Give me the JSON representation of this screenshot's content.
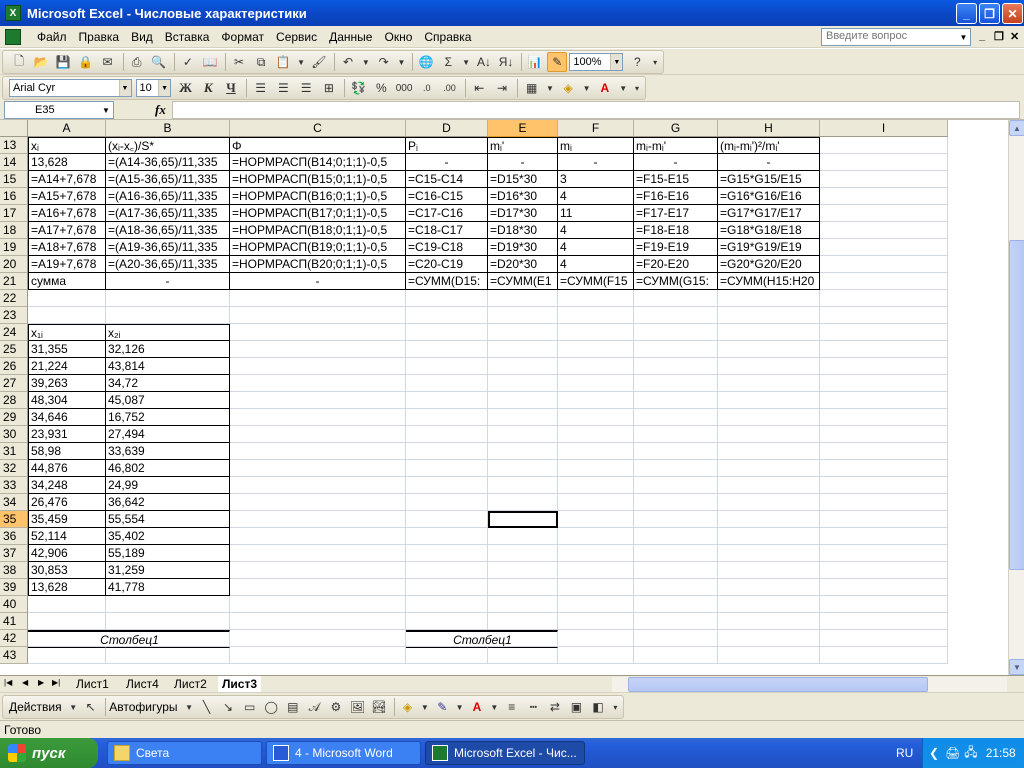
{
  "window": {
    "title": "Microsoft Excel - Числовые характеристики"
  },
  "menu": [
    "Файл",
    "Правка",
    "Вид",
    "Вставка",
    "Формат",
    "Сервис",
    "Данные",
    "Окно",
    "Справка"
  ],
  "help_placeholder": "Введите вопрос",
  "toolbar": {
    "zoom": "100%",
    "font": "Arial Cyr",
    "size": "10",
    "bold": "Ж",
    "italic": "К",
    "underline": "Ч",
    "percent": "%",
    "thousands": "000",
    "sum": "Σ"
  },
  "formula_bar": {
    "namebox": "E35",
    "fx": "fx",
    "content": ""
  },
  "columns": [
    "A",
    "B",
    "C",
    "D",
    "E",
    "F",
    "G",
    "H",
    "I"
  ],
  "rows": [
    {
      "n": "13",
      "cells": [
        "xᵢ",
        "(xᵢ-x꜀)/S*",
        "Φ",
        "Pᵢ",
        "mᵢ'",
        "mᵢ",
        "mᵢ-mᵢ'",
        "(mᵢ-mᵢ')²/mᵢ'",
        ""
      ]
    },
    {
      "n": "14",
      "cells": [
        "13,628",
        "=(A14-36,65)/11,335",
        "=НОРМРАСП(B14;0;1;1)-0,5",
        "-",
        "-",
        "-",
        "-",
        "-",
        ""
      ]
    },
    {
      "n": "15",
      "cells": [
        "=A14+7,678",
        "=(A15-36,65)/11,335",
        "=НОРМРАСП(B15;0;1;1)-0,5",
        "=C15-C14",
        "=D15*30",
        "3",
        "=F15-E15",
        "=G15*G15/E15",
        ""
      ]
    },
    {
      "n": "16",
      "cells": [
        "=A15+7,678",
        "=(A16-36,65)/11,335",
        "=НОРМРАСП(B16;0;1;1)-0,5",
        "=C16-C15",
        "=D16*30",
        "4",
        "=F16-E16",
        "=G16*G16/E16",
        ""
      ]
    },
    {
      "n": "17",
      "cells": [
        "=A16+7,678",
        "=(A17-36,65)/11,335",
        "=НОРМРАСП(B17;0;1;1)-0,5",
        "=C17-C16",
        "=D17*30",
        "11",
        "=F17-E17",
        "=G17*G17/E17",
        ""
      ]
    },
    {
      "n": "18",
      "cells": [
        "=A17+7,678",
        "=(A18-36,65)/11,335",
        "=НОРМРАСП(B18;0;1;1)-0,5",
        "=C18-C17",
        "=D18*30",
        "4",
        "=F18-E18",
        "=G18*G18/E18",
        ""
      ]
    },
    {
      "n": "19",
      "cells": [
        "=A18+7,678",
        "=(A19-36,65)/11,335",
        "=НОРМРАСП(B19;0;1;1)-0,5",
        "=C19-C18",
        "=D19*30",
        "4",
        "=F19-E19",
        "=G19*G19/E19",
        ""
      ]
    },
    {
      "n": "20",
      "cells": [
        "=A19+7,678",
        "=(A20-36,65)/11,335",
        "=НОРМРАСП(B20;0;1;1)-0,5",
        "=C20-C19",
        "=D20*30",
        "4",
        "=F20-E20",
        "=G20*G20/E20",
        ""
      ]
    },
    {
      "n": "21",
      "cells": [
        "сумма",
        "-",
        "-",
        "=СУММ(D15:",
        "=СУММ(E1",
        "=СУММ(F15",
        "=СУММ(G15:",
        "=СУММ(H15:H20",
        ""
      ]
    },
    {
      "n": "22",
      "cells": [
        "",
        "",
        "",
        "",
        "",
        "",
        "",
        "",
        ""
      ]
    },
    {
      "n": "23",
      "cells": [
        "",
        "",
        "",
        "",
        "",
        "",
        "",
        "",
        ""
      ]
    },
    {
      "n": "24",
      "cells": [
        "x₁ᵢ",
        "x₂ᵢ",
        "",
        "",
        "",
        "",
        "",
        "",
        ""
      ]
    },
    {
      "n": "25",
      "cells": [
        "31,355",
        "32,126",
        "",
        "",
        "",
        "",
        "",
        "",
        ""
      ]
    },
    {
      "n": "26",
      "cells": [
        "21,224",
        "43,814",
        "",
        "",
        "",
        "",
        "",
        "",
        ""
      ]
    },
    {
      "n": "27",
      "cells": [
        "39,263",
        "34,72",
        "",
        "",
        "",
        "",
        "",
        "",
        ""
      ]
    },
    {
      "n": "28",
      "cells": [
        "48,304",
        "45,087",
        "",
        "",
        "",
        "",
        "",
        "",
        ""
      ]
    },
    {
      "n": "29",
      "cells": [
        "34,646",
        "16,752",
        "",
        "",
        "",
        "",
        "",
        "",
        ""
      ]
    },
    {
      "n": "30",
      "cells": [
        "23,931",
        "27,494",
        "",
        "",
        "",
        "",
        "",
        "",
        ""
      ]
    },
    {
      "n": "31",
      "cells": [
        "58,98",
        "33,639",
        "",
        "",
        "",
        "",
        "",
        "",
        ""
      ]
    },
    {
      "n": "32",
      "cells": [
        "44,876",
        "46,802",
        "",
        "",
        "",
        "",
        "",
        "",
        ""
      ]
    },
    {
      "n": "33",
      "cells": [
        "34,248",
        "24,99",
        "",
        "",
        "",
        "",
        "",
        "",
        ""
      ]
    },
    {
      "n": "34",
      "cells": [
        "26,476",
        "36,642",
        "",
        "",
        "",
        "",
        "",
        "",
        ""
      ]
    },
    {
      "n": "35",
      "cells": [
        "35,459",
        "55,554",
        "",
        "",
        "",
        "",
        "",
        "",
        ""
      ]
    },
    {
      "n": "36",
      "cells": [
        "52,114",
        "35,402",
        "",
        "",
        "",
        "",
        "",
        "",
        ""
      ]
    },
    {
      "n": "37",
      "cells": [
        "42,906",
        "55,189",
        "",
        "",
        "",
        "",
        "",
        "",
        ""
      ]
    },
    {
      "n": "38",
      "cells": [
        "30,853",
        "31,259",
        "",
        "",
        "",
        "",
        "",
        "",
        ""
      ]
    },
    {
      "n": "39",
      "cells": [
        "13,628",
        "41,778",
        "",
        "",
        "",
        "",
        "",
        "",
        ""
      ]
    },
    {
      "n": "40",
      "cells": [
        "",
        "",
        "",
        "",
        "",
        "",
        "",
        "",
        ""
      ]
    },
    {
      "n": "41",
      "cells": [
        "",
        "",
        "",
        "",
        "",
        "",
        "",
        "",
        ""
      ]
    },
    {
      "n": "42",
      "cells": [
        "Столбец1",
        "",
        "",
        "Столбец1",
        "",
        "",
        "",
        "",
        ""
      ]
    },
    {
      "n": "43",
      "cells": [
        "",
        "",
        "",
        "",
        "",
        "",
        "",
        "",
        ""
      ]
    }
  ],
  "sheet_tabs": [
    "Лист1",
    "Лист4",
    "Лист2",
    "Лист3"
  ],
  "active_sheet": "Лист3",
  "drawbar": {
    "actions": "Действия",
    "autoshapes": "Автофигуры"
  },
  "status": "Готово",
  "taskbar": {
    "start": "пуск",
    "tasks": [
      "Света",
      "4 - Microsoft Word",
      "Microsoft Excel - Чис..."
    ],
    "lang": "RU",
    "clock": "21:58"
  }
}
